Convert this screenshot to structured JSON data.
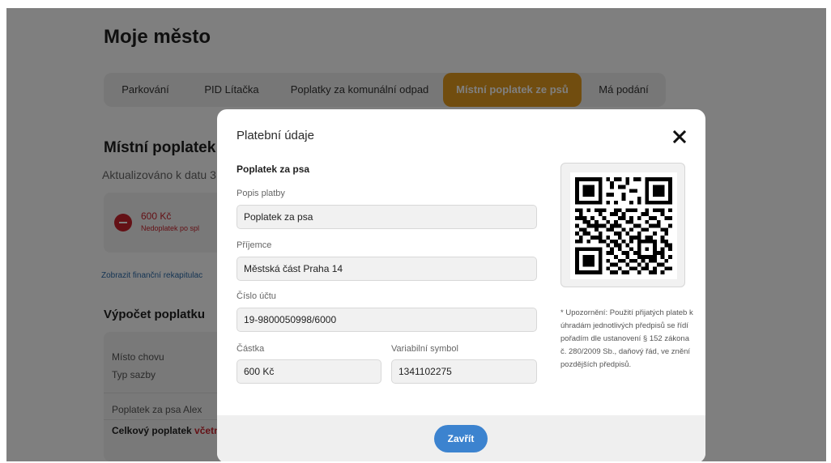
{
  "page": {
    "title": "Moje město"
  },
  "tabs": [
    {
      "label": "Parkování"
    },
    {
      "label": "PID Lítačka"
    },
    {
      "label": "Poplatky za komunální odpad"
    },
    {
      "label": "Místní poplatek ze psů"
    },
    {
      "label": "Má podání"
    }
  ],
  "background": {
    "section_title": "Místní poplatek :",
    "updated": "Aktualizováno k datu 3",
    "balance_amount": "600 Kč",
    "balance_note": "Nedoplatek po spl",
    "recap_link": "Zobrazit finanční rekapitulac",
    "calc_title": "Výpočet poplatku",
    "calc_rows": [
      {
        "label": "Místo chovu"
      },
      {
        "label": "Typ sazby"
      },
      {
        "label": "Poplatek za psa Alex"
      }
    ],
    "total_label": "Celkový poplatek",
    "total_suffix": "včetn"
  },
  "modal": {
    "title": "Platební údaje",
    "subtitle": "Poplatek za psa",
    "fields": {
      "popis": {
        "label": "Popis platby",
        "value": "Poplatek za psa"
      },
      "prijemce": {
        "label": "Příjemce",
        "value": "Městská část Praha 14"
      },
      "ucet": {
        "label": "Číslo účtu",
        "value": "19-9800050998/6000"
      },
      "castka": {
        "label": "Částka",
        "value": "600 Kč"
      },
      "vs": {
        "label": "Variabilní symbol",
        "value": "1341102275"
      }
    },
    "notice": "* Upozornění: Použití přijatých plateb k úhradám jednotlivých předpisů se řídí pořadím dle ustanovení § 152 zákona č. 280/2009 Sb., daňový řád, ve znění pozdějších předpisů.",
    "close_button": "Zavřít",
    "icons": {
      "close": "close-icon",
      "qr": "qr-code-icon"
    }
  },
  "colors": {
    "accent_tab": "#e39a1f",
    "primary_button": "#3c83cf",
    "error": "#c8232c"
  }
}
